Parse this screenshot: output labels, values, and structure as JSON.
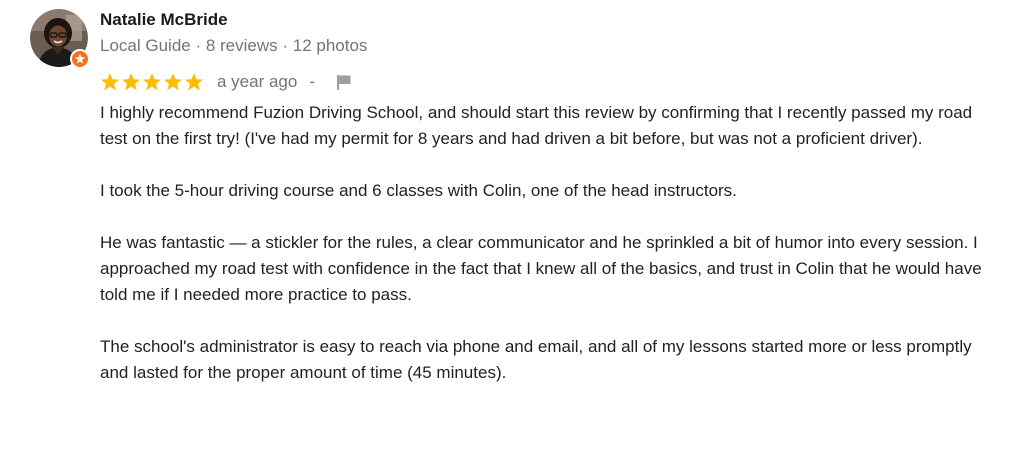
{
  "review": {
    "author": {
      "name": "Natalie McBride",
      "meta": "Local Guide · 8 reviews · 12 photos"
    },
    "rating": 5,
    "rating_max": 5,
    "time": "a year ago",
    "separator": "-",
    "paragraphs": [
      "I highly recommend Fuzion Driving School, and should start this review by confirming that I recently passed my road test on the first try! (I've had my permit for 8 years and had driven a bit before, but was not a proficient driver).",
      "I took the 5-hour driving course and 6 classes with Colin, one of the head instructors.",
      "He was fantastic — a stickler for the rules, a clear communicator and he sprinkled a bit of humor into every session. I approached my road test with confidence in the fact that I knew all of the basics, and trust in Colin that he would have told me if I needed more practice to pass.",
      "The school's administrator is easy to reach via phone and email, and all of my lessons started more or less promptly and lasted for the proper amount of time (45 minutes)."
    ]
  },
  "icons": {
    "avatar": "user-avatar-photo",
    "badge": "local-guide-badge-icon",
    "star": "star-icon",
    "flag": "flag-icon"
  },
  "colors": {
    "star": "#fbbc04",
    "badge": "#f2711c",
    "meta_text": "#70757a",
    "body_text": "#222222"
  }
}
